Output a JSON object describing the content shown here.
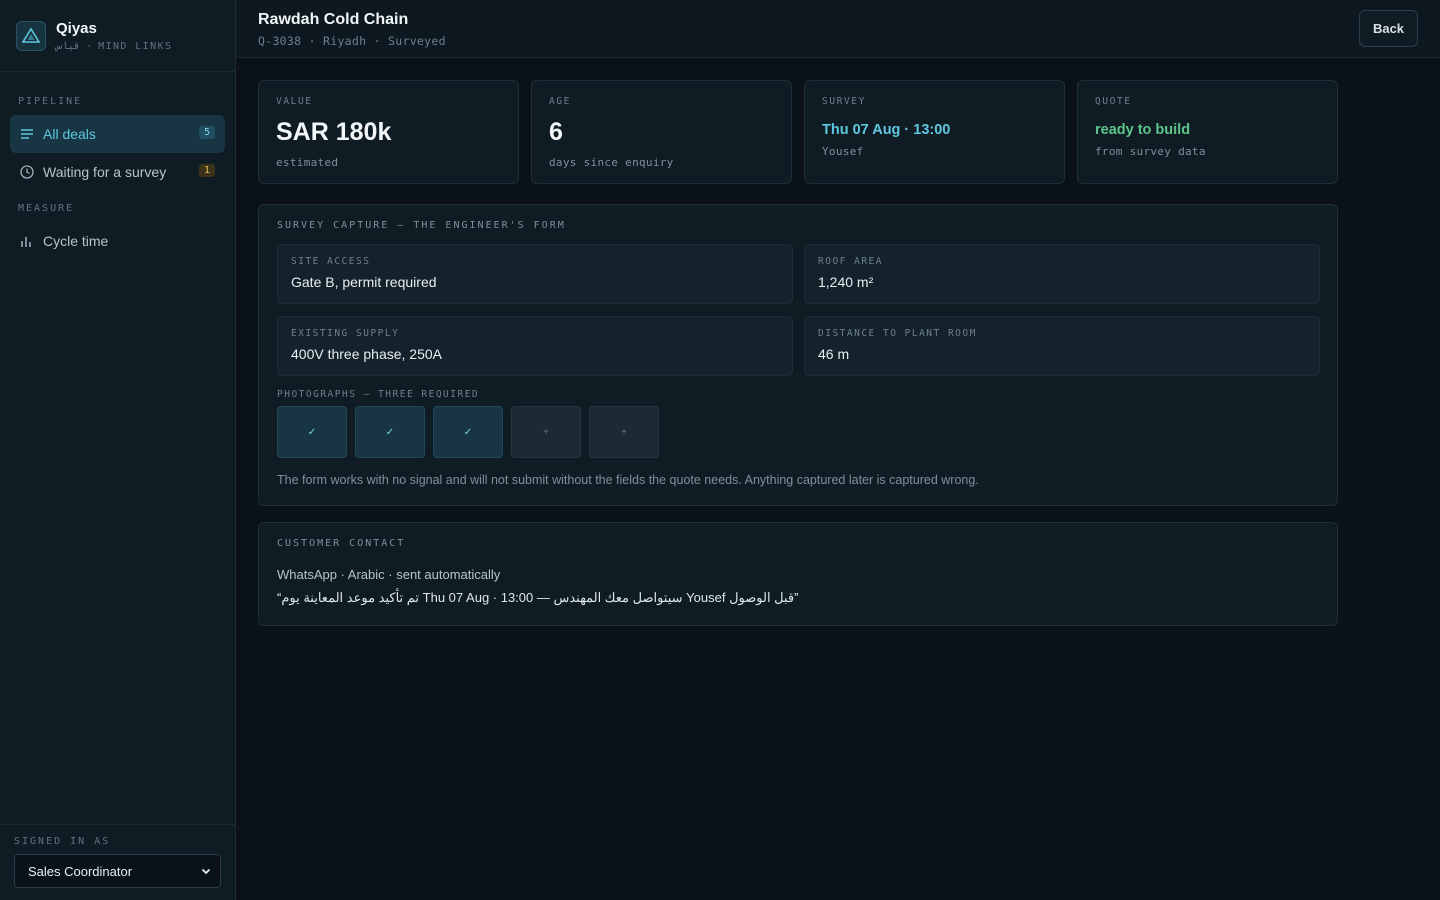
{
  "brand": {
    "name": "Qiyas",
    "subtitle": "قياس · MIND LINKS"
  },
  "sidebar": {
    "sections": [
      {
        "title": "PIPELINE"
      },
      {
        "title": "MEASURE"
      }
    ],
    "items": [
      {
        "label": "All deals",
        "count": "5",
        "icon": "list-icon",
        "active": true
      },
      {
        "label": "Waiting for a survey",
        "count": "1",
        "icon": "clock-icon"
      },
      {
        "label": "Cycle time",
        "icon": "bar-chart-icon"
      }
    ],
    "signed_in": {
      "label": "SIGNED IN AS",
      "role": "Sales Coordinator"
    }
  },
  "header": {
    "title": "Rawdah Cold Chain",
    "meta": "Q-3038 · Riyadh · Surveyed",
    "back_label": "Back"
  },
  "stats": [
    {
      "label": "VALUE",
      "value": "SAR 180k",
      "sub": "estimated"
    },
    {
      "label": "AGE",
      "value": "6",
      "sub": "days since enquiry"
    },
    {
      "label": "SURVEY",
      "value": "Thu 07 Aug · 13:00",
      "sub": "Yousef"
    },
    {
      "label": "QUOTE",
      "value": "ready to build",
      "sub": "from survey data"
    }
  ],
  "survey": {
    "title": "SURVEY CAPTURE — THE ENGINEER'S FORM",
    "fields": [
      {
        "label": "SITE ACCESS",
        "value": "Gate B, permit required"
      },
      {
        "label": "ROOF AREA",
        "value": "1,240 m²"
      },
      {
        "label": "EXISTING SUPPLY",
        "value": "400V three phase, 250A"
      },
      {
        "label": "DISTANCE TO PLANT ROOM",
        "value": "46 m"
      }
    ],
    "photos_label": "PHOTOGRAPHS — THREE REQUIRED",
    "photos": [
      "✓",
      "✓",
      "✓",
      "+",
      "+"
    ],
    "note": "The form works with no signal and will not submit without the fields the quote needs. Anything captured later is captured wrong."
  },
  "contact": {
    "title": "CUSTOMER CONTACT",
    "channel": "WhatsApp · Arabic · sent automatically",
    "message": "“تم تأكيد موعد المعاينة يوم Thu 07 Aug · 13:00 — سيتواصل معك المهندس Yousef قبل الوصول”"
  },
  "colors": {
    "accent": "#5fc8e0",
    "success": "#5cc58a",
    "background": "#0a1118",
    "panel": "#101c24"
  }
}
